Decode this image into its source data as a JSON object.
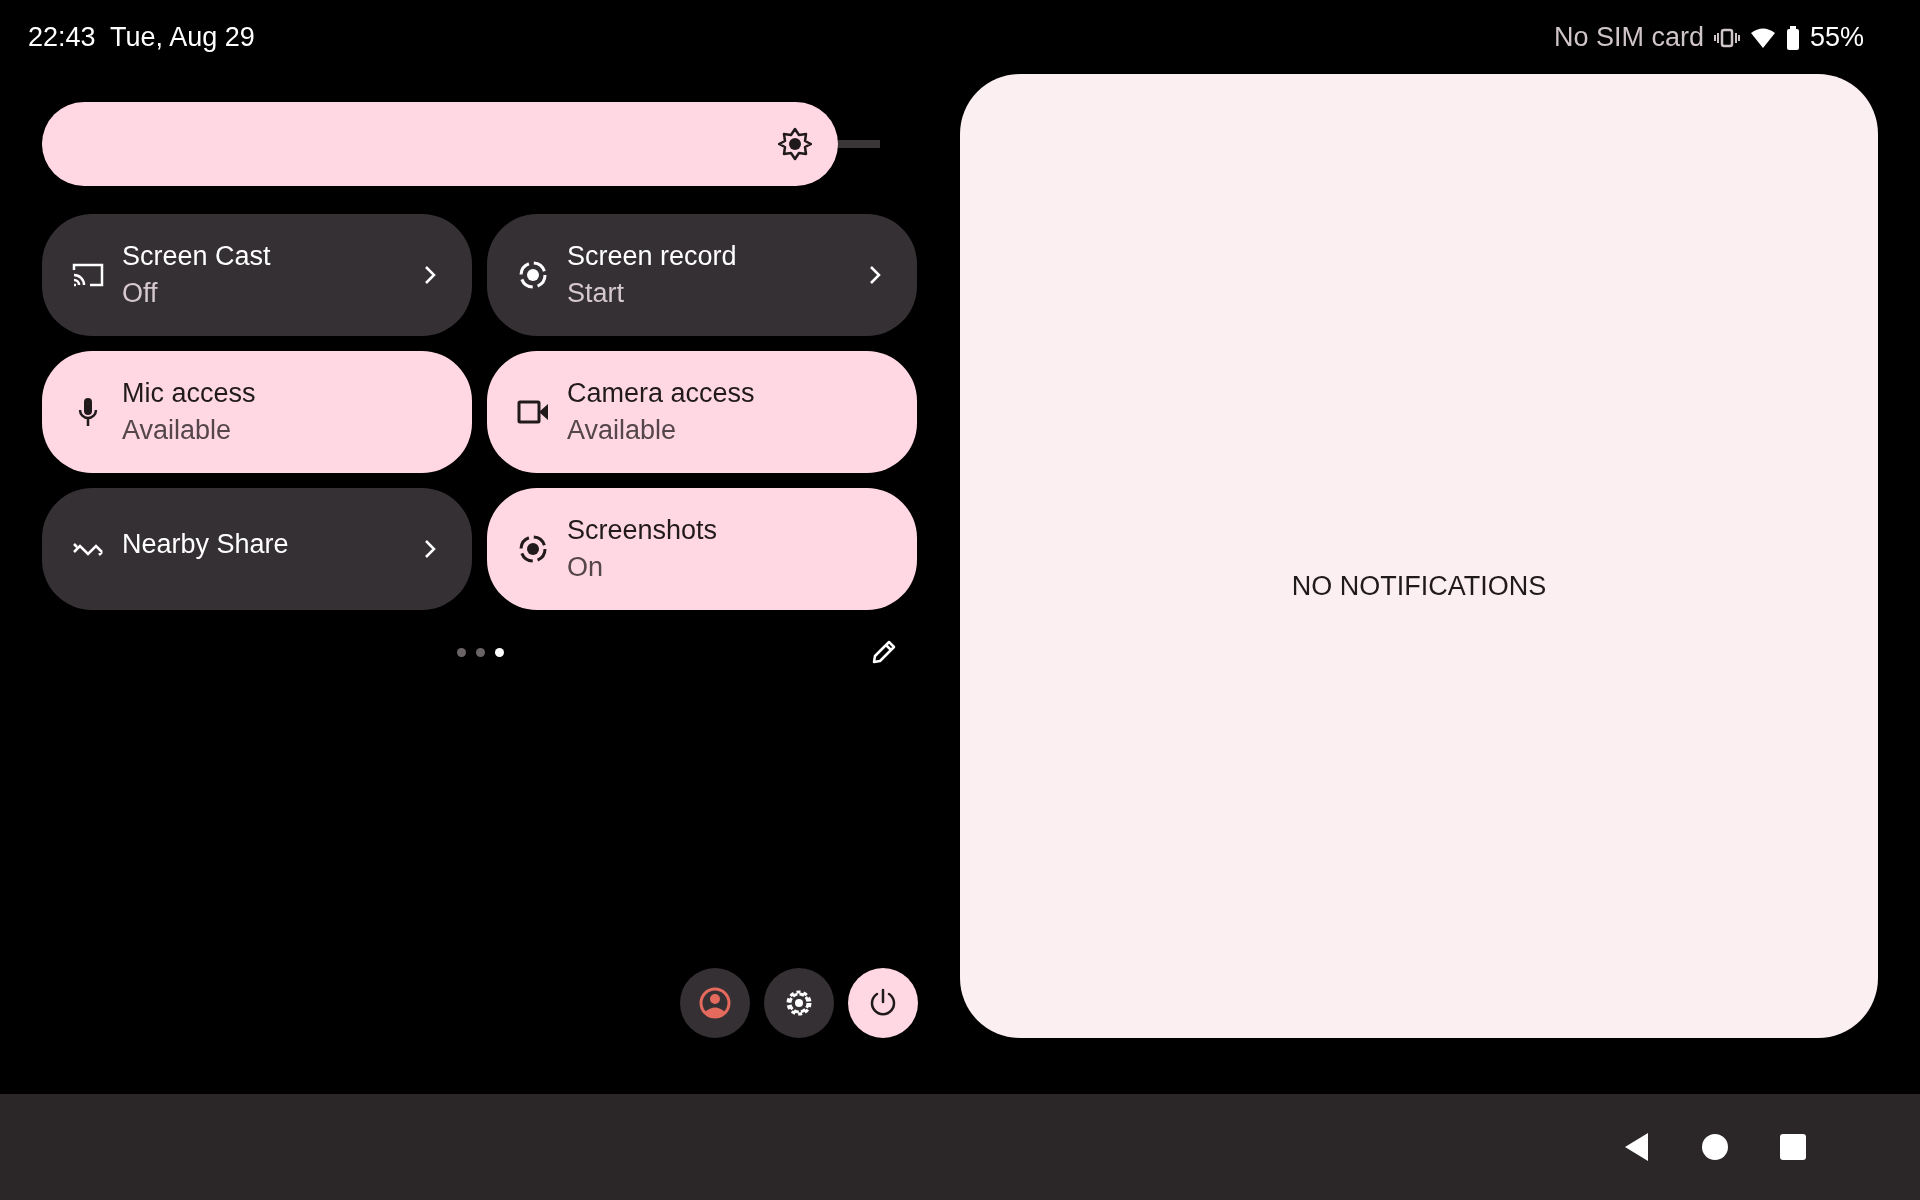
{
  "status_bar": {
    "time": "22:43",
    "date": "Tue, Aug 29",
    "carrier": "No SIM card",
    "battery": "55%"
  },
  "brightness": {
    "level": 0.95
  },
  "tiles": [
    {
      "title": "Screen Cast",
      "subtitle": "Off",
      "active": false,
      "chevron": true
    },
    {
      "title": "Screen record",
      "subtitle": "Start",
      "active": false,
      "chevron": true
    },
    {
      "title": "Mic access",
      "subtitle": "Available",
      "active": true,
      "chevron": false
    },
    {
      "title": "Camera access",
      "subtitle": "Available",
      "active": true,
      "chevron": false
    },
    {
      "title": "Nearby Share",
      "active": false,
      "chevron": true
    },
    {
      "title": "Screenshots",
      "subtitle": "On",
      "active": true,
      "chevron": false
    }
  ],
  "page_indicator": [
    {
      "selected": false
    },
    {
      "selected": false
    },
    {
      "selected": true
    }
  ],
  "notifications": {
    "message": "NO NOTIFICATIONS"
  }
}
